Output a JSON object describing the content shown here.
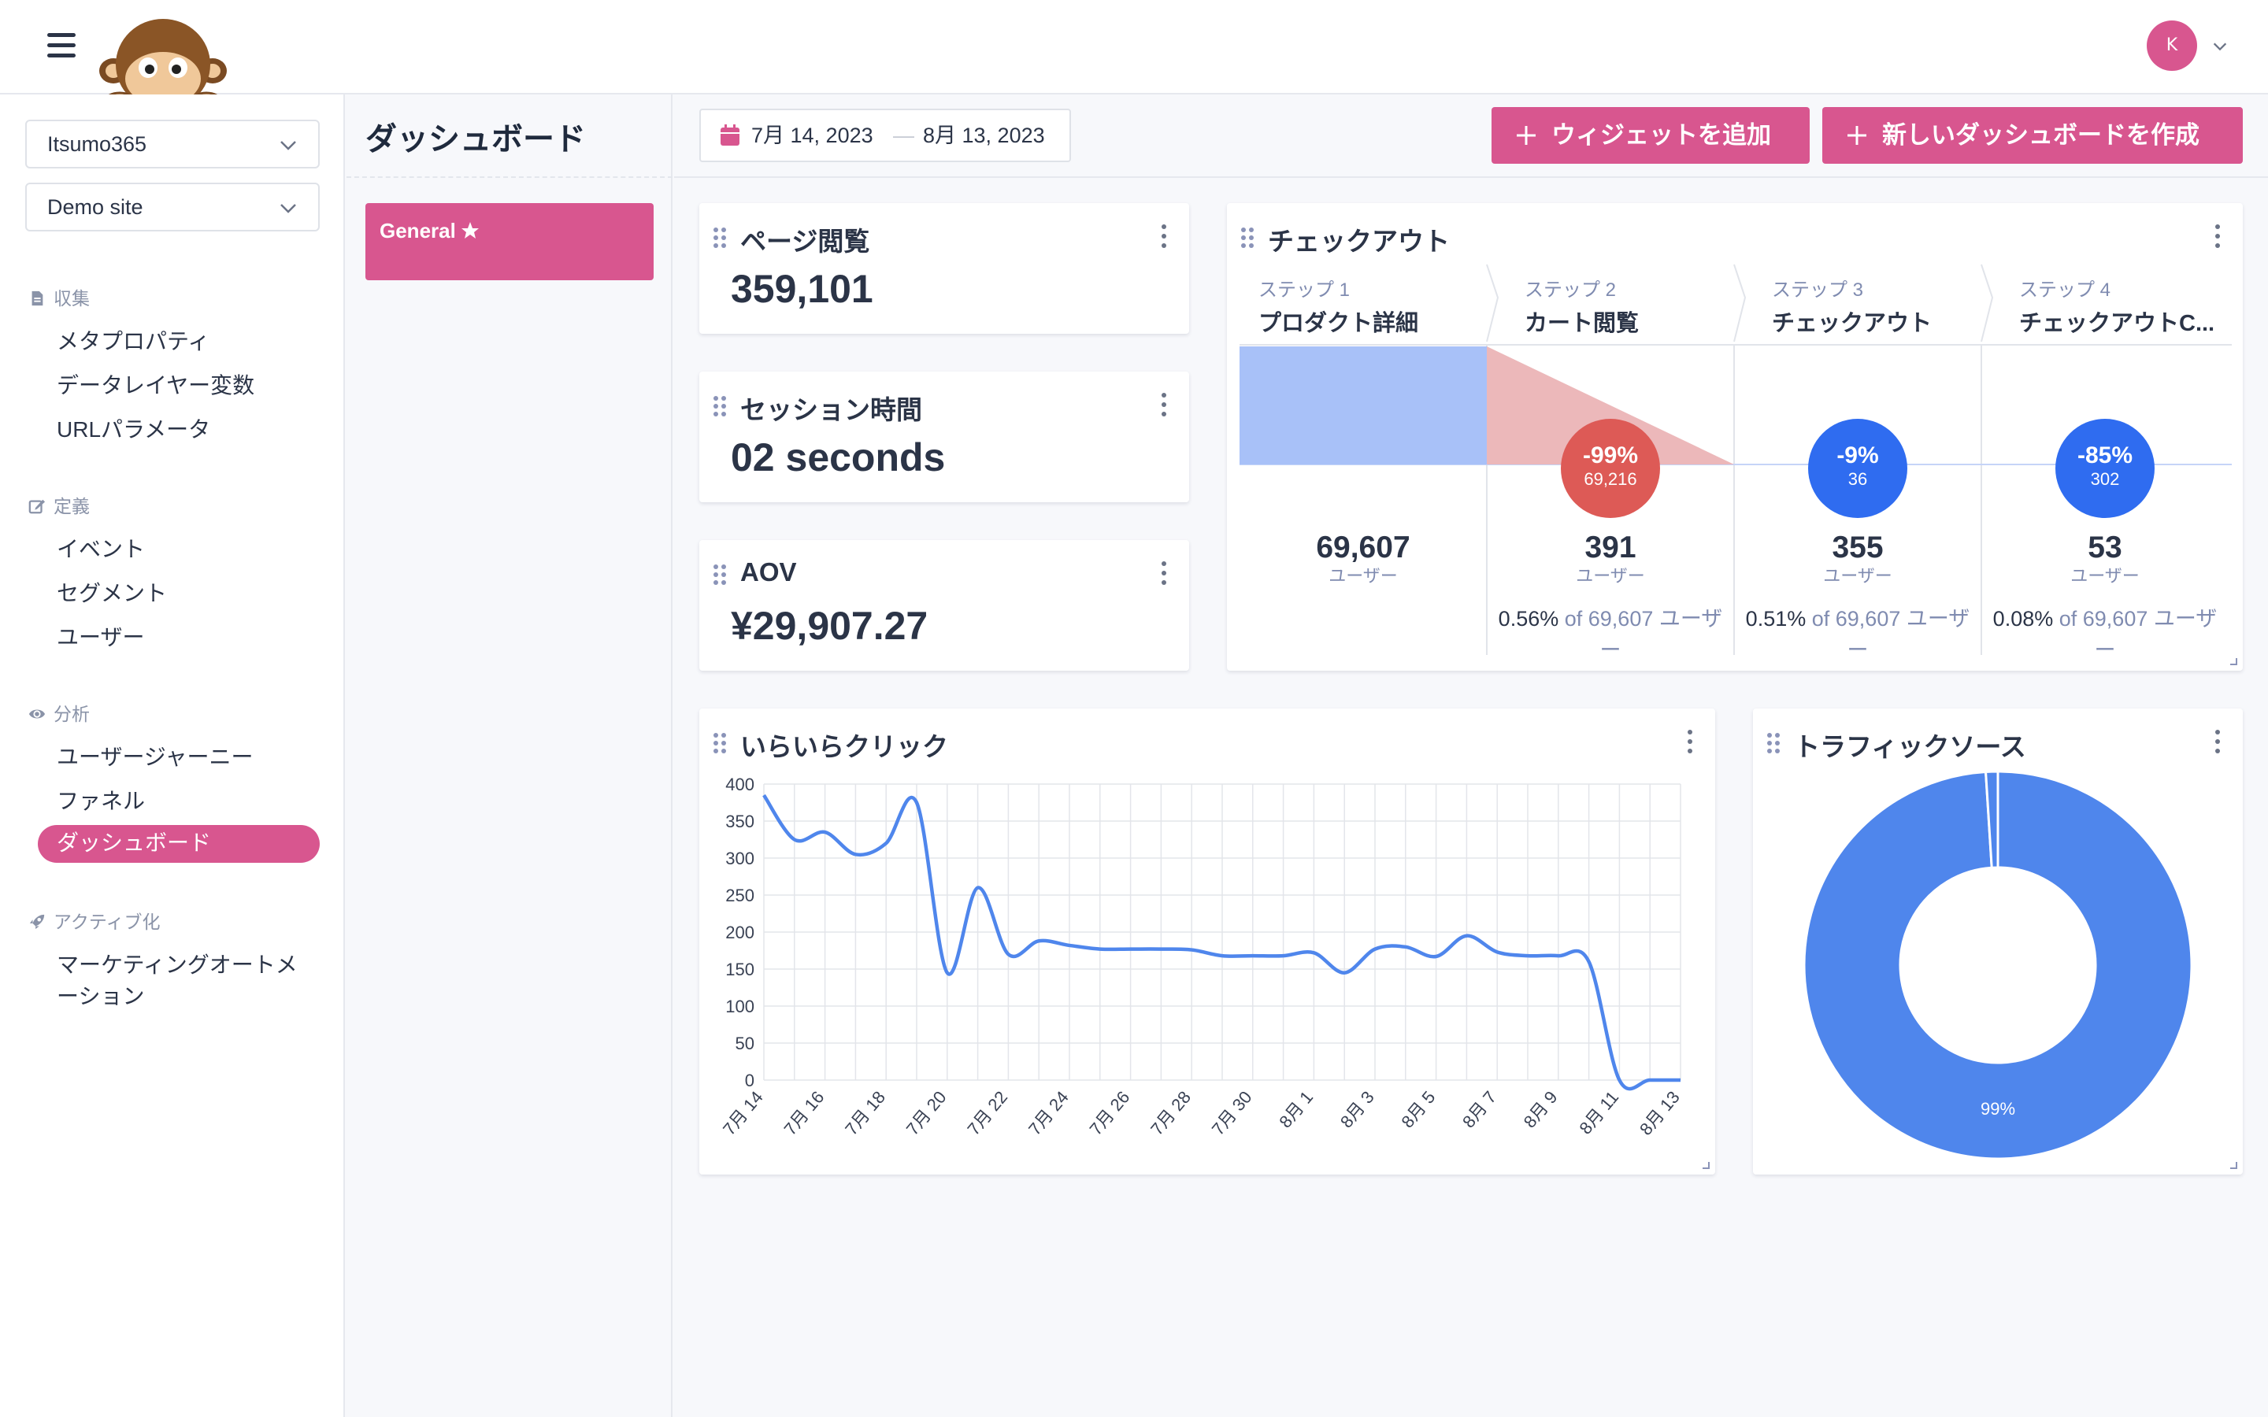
{
  "topbar": {
    "avatar_initial": "K"
  },
  "sidebar": {
    "account_select": "Itsumo365",
    "site_select": "Demo site",
    "sections": [
      {
        "heading": "収集",
        "icon": "document-icon",
        "items": [
          "メタプロパティ",
          "データレイヤー変数",
          "URLパラメータ"
        ]
      },
      {
        "heading": "定義",
        "icon": "edit-icon",
        "items": [
          "イベント",
          "セグメント",
          "ユーザー"
        ]
      },
      {
        "heading": "分析",
        "icon": "eye-icon",
        "items": [
          "ユーザージャーニー",
          "ファネル",
          "ダッシュボード"
        ]
      },
      {
        "heading": "アクティブ化",
        "icon": "rocket-icon",
        "items": [
          "マーケティングオートメ",
          "ーション"
        ]
      }
    ],
    "active_item": "ダッシュボード"
  },
  "dashboards": {
    "title": "ダッシュボード",
    "tabs": [
      {
        "label": "General",
        "starred": true
      }
    ]
  },
  "toolbar": {
    "date_from": "7月 14, 2023",
    "date_to": "8月 13, 2023",
    "date_separator": "—",
    "add_widget_label": "ウィジェットを追加",
    "new_dashboard_label": "新しいダッシュボードを作成"
  },
  "widgets": {
    "pageviews": {
      "title": "ページ閲覧",
      "value": "359,101"
    },
    "session": {
      "title": "セッション時間",
      "value": "02 seconds"
    },
    "aov": {
      "title": "AOV",
      "value": "¥29,907.27"
    },
    "checkout": {
      "title": "チェックアウト",
      "steps": [
        {
          "label": "ステップ 1",
          "name": "プロダクト詳細",
          "count": "69,607",
          "unit": "ユーザー",
          "pct": "",
          "of": "",
          "drop_pct": "",
          "drop_count": ""
        },
        {
          "label": "ステップ 2",
          "name": "カート閲覧",
          "count": "391",
          "unit": "ユーザー",
          "pct": "0.56%",
          "of": "of 69,607 ユーザ",
          "of_wrap": "ー",
          "drop_pct": "-99%",
          "drop_count": "69,216"
        },
        {
          "label": "ステップ 3",
          "name": "チェックアウト",
          "count": "355",
          "unit": "ユーザー",
          "pct": "0.51%",
          "of": "of 69,607 ユーザ",
          "of_wrap": "ー",
          "drop_pct": "-9%",
          "drop_count": "36"
        },
        {
          "label": "ステップ 4",
          "name": "チェックアウトC...",
          "count": "53",
          "unit": "ユーザー",
          "pct": "0.08%",
          "of": "of 69,607 ユーザ",
          "of_wrap": "ー",
          "drop_pct": "-85%",
          "drop_count": "302"
        }
      ]
    },
    "irritation": {
      "title": "いらいらクリック"
    },
    "traffic": {
      "title": "トラフィックソース",
      "slice_label": "99%"
    }
  },
  "colors": {
    "accent": "#d8568f",
    "line": "#4f86ec",
    "funnel_bar": "#a8c1f8",
    "funnel_drop": "#ecb8ba",
    "drop_red": "#dd5a56",
    "drop_blue": "#2f6cf0"
  },
  "chart_data": [
    {
      "type": "line",
      "title": "いらいらクリック",
      "ylim": [
        0,
        400
      ],
      "yticks": [
        0,
        50,
        100,
        150,
        200,
        250,
        300,
        350,
        400
      ],
      "x_labels": [
        "7月 14",
        "7月 16",
        "7月 18",
        "7月 20",
        "7月 22",
        "7月 24",
        "7月 26",
        "7月 28",
        "7月 30",
        "8月 1",
        "8月 3",
        "8月 5",
        "8月 7",
        "8月 9",
        "8月 11",
        "8月 13"
      ],
      "x": [
        "7月 14",
        "7月 15",
        "7月 16",
        "7月 17",
        "7月 18",
        "7月 19",
        "7月 20",
        "7月 21",
        "7月 22",
        "7月 23",
        "7月 24",
        "7月 25",
        "7月 26",
        "7月 27",
        "7月 28",
        "7月 29",
        "7月 30",
        "7月 31",
        "8月 1",
        "8月 2",
        "8月 3",
        "8月 4",
        "8月 5",
        "8月 6",
        "8月 7",
        "8月 8",
        "8月 9",
        "8月 10",
        "8月 11",
        "8月 12",
        "8月 13"
      ],
      "values": [
        385,
        325,
        335,
        305,
        320,
        375,
        145,
        260,
        170,
        188,
        182,
        177,
        177,
        177,
        176,
        168,
        168,
        168,
        172,
        145,
        177,
        180,
        167,
        195,
        173,
        168,
        168,
        160,
        0,
        0,
        0
      ]
    },
    {
      "type": "pie",
      "title": "トラフィックソース",
      "values": [
        99,
        1
      ],
      "labels": [
        "99%"
      ]
    }
  ]
}
